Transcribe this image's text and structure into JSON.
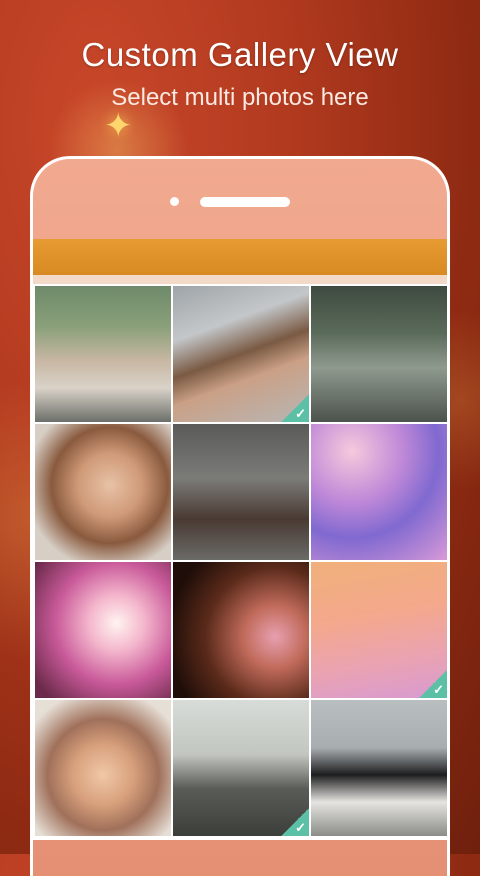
{
  "promo": {
    "title": "Custom Gallery View",
    "subtitle": "Select multi photos here"
  },
  "colors": {
    "background": "#b23a1f",
    "phone_frame": "#ffffff",
    "app_bar": "#e79b33",
    "check_badge": "#5bc0a6"
  },
  "gallery": {
    "photos": [
      {
        "subject": "three girls on bench",
        "selected": false
      },
      {
        "subject": "two girls with sunglasses",
        "selected": true
      },
      {
        "subject": "woman sitting on log in forest",
        "selected": false
      },
      {
        "subject": "smiling girl portrait",
        "selected": false
      },
      {
        "subject": "woman walking in woods",
        "selected": false
      },
      {
        "subject": "purple bokeh",
        "selected": false
      },
      {
        "subject": "pink light blur",
        "selected": false
      },
      {
        "subject": "dark orange light flare",
        "selected": false
      },
      {
        "subject": "peach gradient",
        "selected": true
      },
      {
        "subject": "two laughing girls",
        "selected": false
      },
      {
        "subject": "skateboarders on road",
        "selected": true
      },
      {
        "subject": "woman sitting on wall",
        "selected": false
      }
    ]
  }
}
